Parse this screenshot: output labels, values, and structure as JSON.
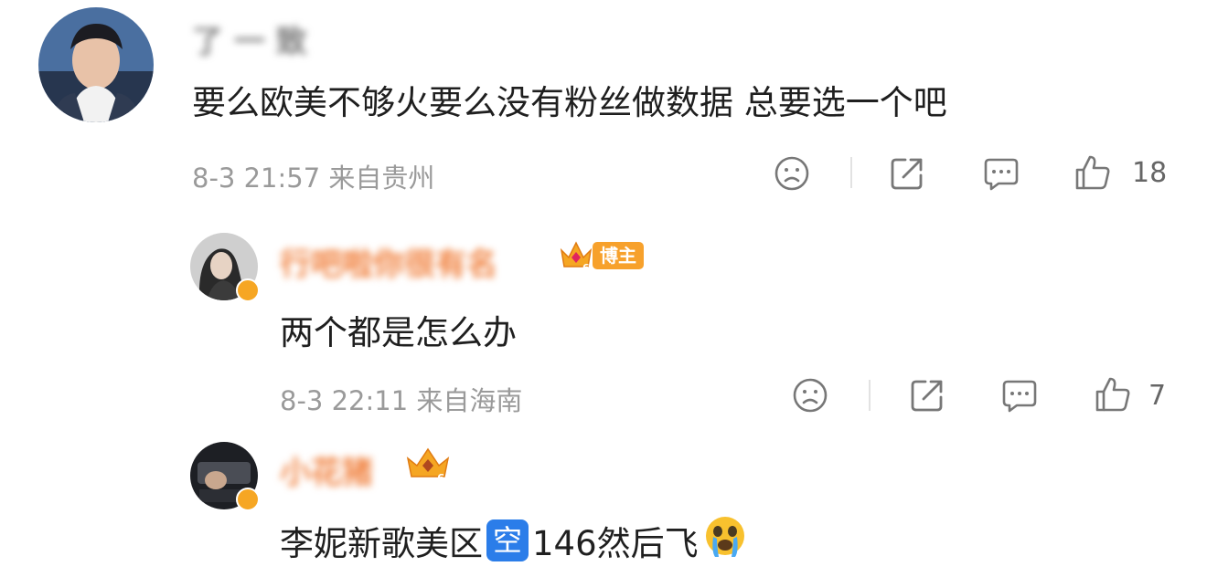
{
  "comments": [
    {
      "username": "了 一 致",
      "content": "要么欧美不够火要么没有粉丝做数据 总要选一个吧",
      "meta": "8-3 21:57 来自贵州",
      "likes": "18"
    },
    {
      "username": "行吧啦你很有名",
      "badge_label": "博主",
      "badge_level": "6",
      "content": "两个都是怎么办",
      "meta": "8-3 22:11 来自海南",
      "likes": "7"
    },
    {
      "username": "小花猪",
      "badge_level": "6",
      "content_before": "李妮新歌美区",
      "content_emoji": "空",
      "content_after": "146然后飞",
      "emoji": "crying-face-emoji"
    }
  ],
  "colors": {
    "meta": "#9a9a9a",
    "verified": "#f6a623",
    "emoji_square": "#2b7de9"
  }
}
